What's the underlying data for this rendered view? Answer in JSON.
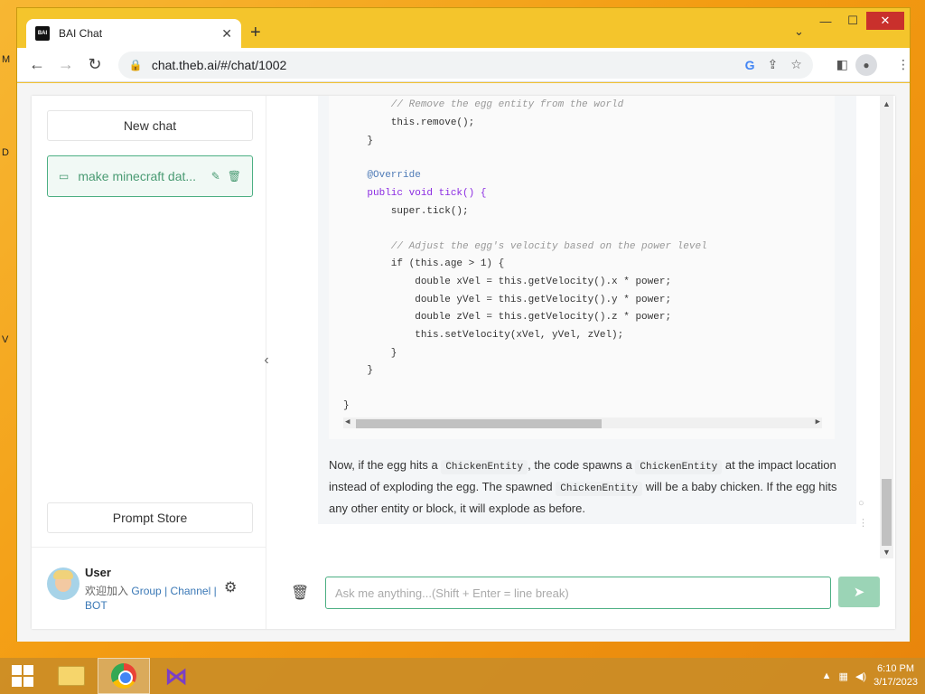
{
  "desktop": {
    "letters": [
      "M",
      "D",
      "V"
    ]
  },
  "browser": {
    "tab_title": "BAI Chat",
    "tab_favicon_text": "BAI",
    "tab_close": "✕",
    "new_tab": "+",
    "tab_search": "⌄",
    "win_minimize": "—",
    "win_maximize": "☐",
    "win_close": "✕",
    "url": "chat.theb.ai/#/chat/1002",
    "google_letter": "G"
  },
  "sidebar": {
    "new_chat_label": "New chat",
    "chat_items": [
      {
        "label": "make minecraft dat..."
      }
    ],
    "prompt_store_label": "Prompt Store",
    "user": {
      "name": "User",
      "sub_prefix": "欢迎加入",
      "link_group": "Group",
      "sep1": "|",
      "link_channel": "Channel",
      "sep2": "|",
      "link_bot": "BOT"
    }
  },
  "message": {
    "code_lines": [
      "        // Remove the egg entity from the world",
      "        this.remove();",
      "    }",
      "",
      "    @Override",
      "    public void tick() {",
      "        super.tick();",
      "",
      "        // Adjust the egg's velocity based on the power level",
      "        if (this.age > 1) {",
      "            double xVel = this.getVelocity().x * power;",
      "            double yVel = this.getVelocity().y * power;",
      "            double zVel = this.getVelocity().z * power;",
      "            this.setVelocity(xVel, yVel, zVel);",
      "        }",
      "    }",
      "",
      "}"
    ],
    "text": {
      "p1": "Now, if the egg hits a",
      "code1": "ChickenEntity",
      "p2": ", the code spawns a",
      "code2": "ChickenEntity",
      "p3": "at the impact location instead of exploding the egg. The spawned",
      "code3": "ChickenEntity",
      "p4": "will be a baby chicken. If the egg hits any other entity or block, it will explode as before."
    }
  },
  "composer": {
    "placeholder": "Ask me anything...(Shift + Enter = line break)"
  },
  "taskbar": {
    "time": "6:10 PM",
    "date": "3/17/2023"
  }
}
